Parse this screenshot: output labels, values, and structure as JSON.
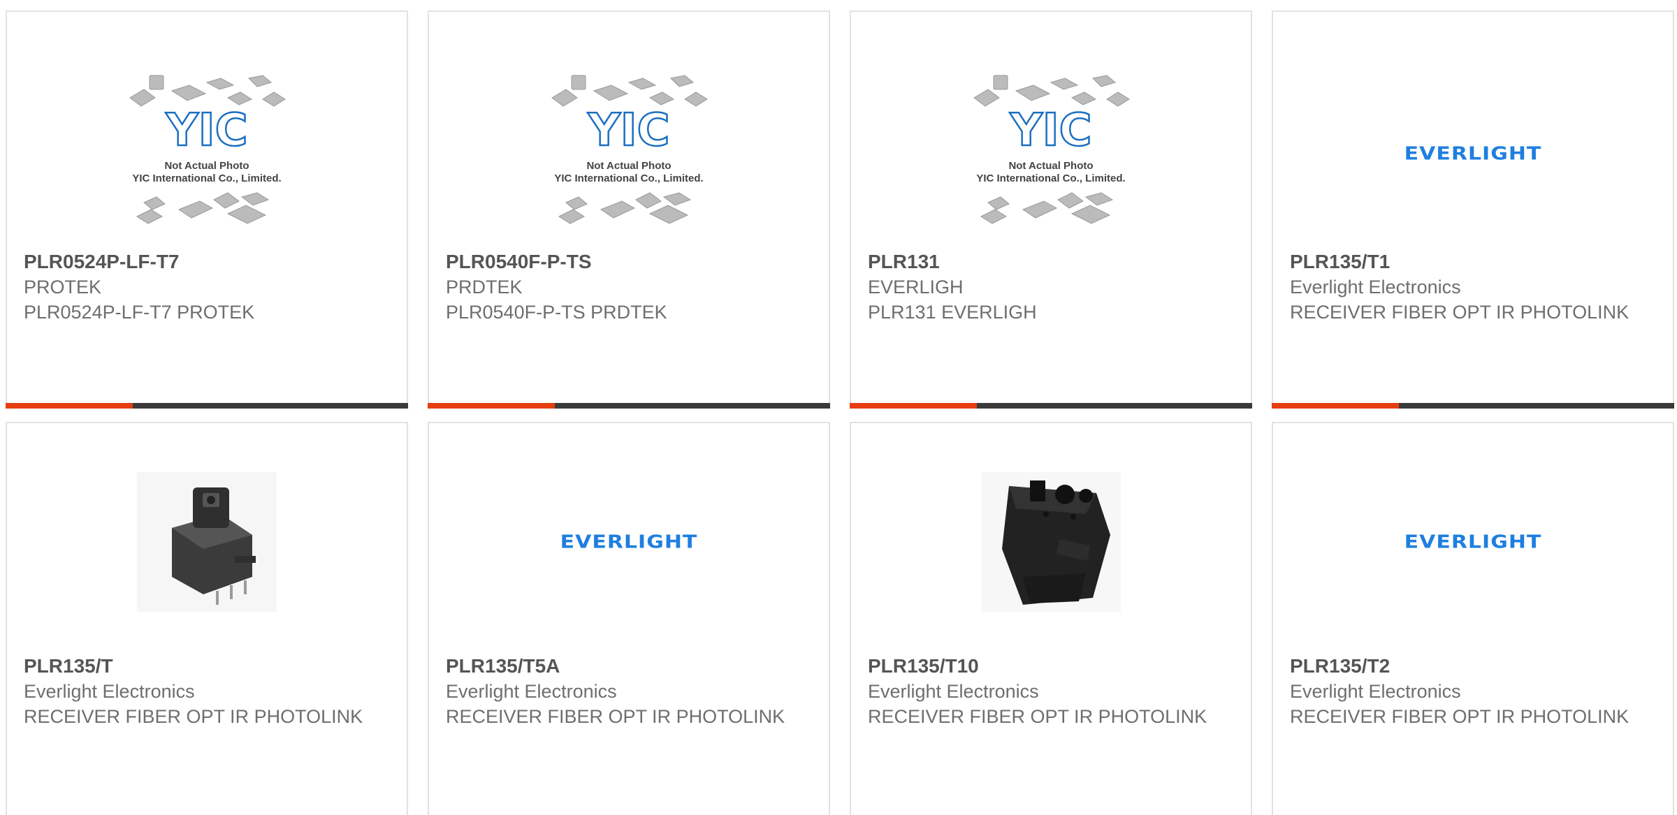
{
  "placeholder_image": {
    "logo_text": "YIC",
    "caption_line1": "Not Actual Photo",
    "caption_line2": "YIC International Co., Limited."
  },
  "brand_logo": {
    "text": "EVERLIGHT",
    "color": "#1f7fe0"
  },
  "colors": {
    "accent": "#e63d11",
    "bar": "#3a3a3a",
    "border": "#e2e2e2"
  },
  "products": [
    {
      "part_number": "PLR0524P-LF-T7",
      "manufacturer": "PROTEK",
      "description": "PLR0524P-LF-T7 PROTEK",
      "image": "placeholder"
    },
    {
      "part_number": "PLR0540F-P-TS",
      "manufacturer": "PRDTEK",
      "description": "PLR0540F-P-TS PRDTEK",
      "image": "placeholder"
    },
    {
      "part_number": "PLR131",
      "manufacturer": "EVERLIGH",
      "description": "PLR131 EVERLIGH",
      "image": "placeholder"
    },
    {
      "part_number": "PLR135/T1",
      "manufacturer": "Everlight Electronics",
      "description": "RECEIVER FIBER OPT IR PHOTOLINK",
      "image": "everlight-logo"
    },
    {
      "part_number": "PLR135/T",
      "manufacturer": "Everlight Electronics",
      "description": "RECEIVER FIBER OPT IR PHOTOLINK",
      "image": "fiber-receiver-photo"
    },
    {
      "part_number": "PLR135/T5A",
      "manufacturer": "Everlight Electronics",
      "description": "RECEIVER FIBER OPT IR PHOTOLINK",
      "image": "everlight-logo"
    },
    {
      "part_number": "PLR135/T10",
      "manufacturer": "Everlight Electronics",
      "description": "RECEIVER FIBER OPT IR PHOTOLINK",
      "image": "black-housing-photo"
    },
    {
      "part_number": "PLR135/T2",
      "manufacturer": "Everlight Electronics",
      "description": "RECEIVER FIBER OPT IR PHOTOLINK",
      "image": "everlight-logo"
    }
  ]
}
